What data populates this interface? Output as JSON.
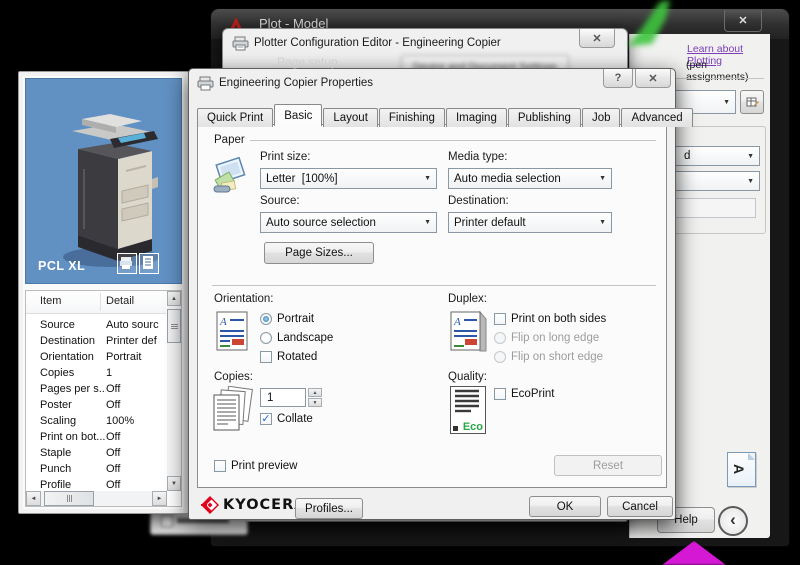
{
  "icons": {
    "dropdown_arrow": "▼",
    "close": "✕",
    "help": "?",
    "scroll_up": "▲",
    "scroll_down": "▼",
    "scroll_left": "◄",
    "scroll_right": "►",
    "collapse_left": "‹",
    "checkmark": "✓",
    "spinner_up": "▲",
    "spinner_down": "▼"
  },
  "colors": {
    "panel_blue": "#6190c3",
    "link_purple": "#7b3db8",
    "kyocera_red": "#e2001a",
    "eco_green": "#27a845",
    "cursor_green": "#3ec43e",
    "artifact_magenta": "#d418d4"
  },
  "plot_window": {
    "title": "Plot - Model",
    "page_setup_label": "Page setup",
    "learn_link": "Learn about Plotting",
    "pen_assignments_text": "(pen assignments)",
    "shade_combo_clipped_text": "d",
    "help_button": "Help",
    "orientation_icon_letter": "A"
  },
  "pce_dialog": {
    "title": "Plotter Configuration Editor - Engineering Copier",
    "blurred_tab_label": "Device and Document Settings"
  },
  "left_panel": {
    "driver_label": "PCL XL",
    "table": {
      "item_header": "Item",
      "detail_header": "Detail",
      "rows": [
        {
          "item": "Source",
          "detail": "Auto sourc"
        },
        {
          "item": "Destination",
          "detail": "Printer def"
        },
        {
          "item": "Orientation",
          "detail": "Portrait"
        },
        {
          "item": "Copies",
          "detail": "1"
        },
        {
          "item": "Pages per s...",
          "detail": "Off"
        },
        {
          "item": "Poster",
          "detail": "Off"
        },
        {
          "item": "Scaling",
          "detail": "100%"
        },
        {
          "item": "Print on bot...",
          "detail": "Off"
        },
        {
          "item": "Staple",
          "detail": "Off"
        },
        {
          "item": "Punch",
          "detail": "Off"
        },
        {
          "item": "Profile",
          "detail": "Off"
        }
      ]
    }
  },
  "props_dialog": {
    "title": "Engineering Copier Properties",
    "tabs": [
      "Quick Print",
      "Basic",
      "Layout",
      "Finishing",
      "Imaging",
      "Publishing",
      "Job",
      "Advanced"
    ],
    "paper": {
      "group_label": "Paper",
      "print_size_label": "Print size:",
      "print_size_value": "Letter  [100%]",
      "media_type_label": "Media type:",
      "media_type_value": "Auto media selection",
      "source_label": "Source:",
      "source_value": "Auto source selection",
      "destination_label": "Destination:",
      "destination_value": "Printer default",
      "page_sizes_button": "Page Sizes..."
    },
    "orientation": {
      "group_label": "Orientation:",
      "portrait_label": "Portrait",
      "landscape_label": "Landscape",
      "rotated_label": "Rotated"
    },
    "duplex": {
      "group_label": "Duplex:",
      "both_sides_label": "Print on both sides",
      "long_edge_label": "Flip on long edge",
      "short_edge_label": "Flip on short edge"
    },
    "copies": {
      "group_label": "Copies:",
      "count_value": "1",
      "collate_label": "Collate"
    },
    "quality": {
      "group_label": "Quality:",
      "ecoprint_label": "EcoPrint",
      "eco_badge": "Eco"
    },
    "print_preview_label": "Print preview",
    "reset_button": "Reset",
    "brand": "KYOCERA",
    "profiles_button": "Profiles...",
    "ok_button": "OK",
    "cancel_button": "Cancel"
  }
}
